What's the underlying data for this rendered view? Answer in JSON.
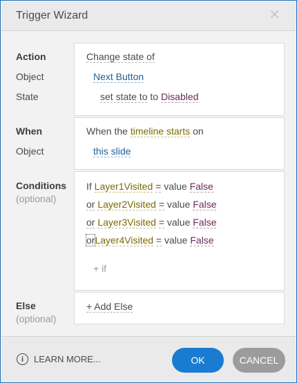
{
  "window": {
    "title": "Trigger Wizard",
    "close_glyph": "✕"
  },
  "action_section": {
    "labels": {
      "action": "Action",
      "object": "Object",
      "state": "State"
    },
    "action_value": "Change state of",
    "object_value": "Next Button",
    "state_prefix": "set state to",
    "state_value": "Disabled"
  },
  "when_section": {
    "labels": {
      "when": "When",
      "object": "Object"
    },
    "prefix": "When the",
    "event": "timeline starts",
    "suffix": "on",
    "object_value": "this slide"
  },
  "conditions_section": {
    "label": "Conditions",
    "sublabel": "(optional)",
    "rows": [
      {
        "keyword": "If",
        "variable": "Layer1Visited",
        "operator": "=",
        "type": "value",
        "value": "False"
      },
      {
        "keyword": "or",
        "variable": "Layer2Visited",
        "operator": "=",
        "type": "value",
        "value": "False"
      },
      {
        "keyword": "or",
        "variable": "Layer3Visited",
        "operator": "=",
        "type": "value",
        "value": "False"
      },
      {
        "keyword": "or",
        "variable": "Layer4Visited",
        "operator": "=",
        "type": "value",
        "value": "False"
      }
    ],
    "add_if": "+ if"
  },
  "else_section": {
    "label": "Else",
    "sublabel": "(optional)",
    "add_else": "+ Add Else"
  },
  "footer": {
    "info_icon": "info-icon",
    "learn_more": "LEARN MORE...",
    "ok": "OK",
    "cancel": "CANCEL"
  },
  "colors": {
    "accent": "#1a7cd0",
    "cancel": "#9c9c9c",
    "variable": "#7a6a00",
    "value": "#6b2a5a",
    "link": "#1f5f95"
  }
}
